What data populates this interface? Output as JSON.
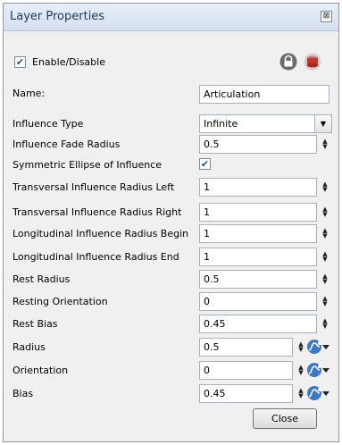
{
  "title": "Layer Properties",
  "close_glyph": "⊠",
  "enable": {
    "label": "Enable/Disable",
    "checked": true
  },
  "name": {
    "label": "Name:",
    "value": "Articulation"
  },
  "influence_type": {
    "label": "Influence Type",
    "value": "Infinite"
  },
  "rows": [
    {
      "label": "Influence Fade Radius",
      "value": "0.5"
    },
    {
      "label": "Symmetric Ellipse of Influence",
      "checked": true
    },
    {
      "label": "Transversal Influence Radius Left",
      "value": "1"
    },
    {
      "label": "Transversal Influence Radius Right",
      "value": "1"
    },
    {
      "label": "Longitudinal Influence Radius Begin",
      "value": "1"
    },
    {
      "label": "Longitudinal Influence Radius End",
      "value": "1"
    },
    {
      "label": "Rest Radius",
      "value": "0.5"
    },
    {
      "label": "Resting Orientation",
      "value": "0"
    },
    {
      "label": "Rest Bias",
      "value": "0.45"
    },
    {
      "label": "Radius",
      "value": "0.5"
    },
    {
      "label": "Orientation",
      "value": "0"
    },
    {
      "label": "Bias",
      "value": "0.45"
    }
  ],
  "icons": {
    "lock": "lock-icon",
    "layer": "layer-color-icon",
    "function": "function-curve-icon"
  },
  "close_button": "Close",
  "colors": {
    "title_text": "#1e395b",
    "check": "#2a4f8f",
    "func_blue": "#3c78c8",
    "lock": "#555555",
    "layer_red": "#c0392b"
  }
}
